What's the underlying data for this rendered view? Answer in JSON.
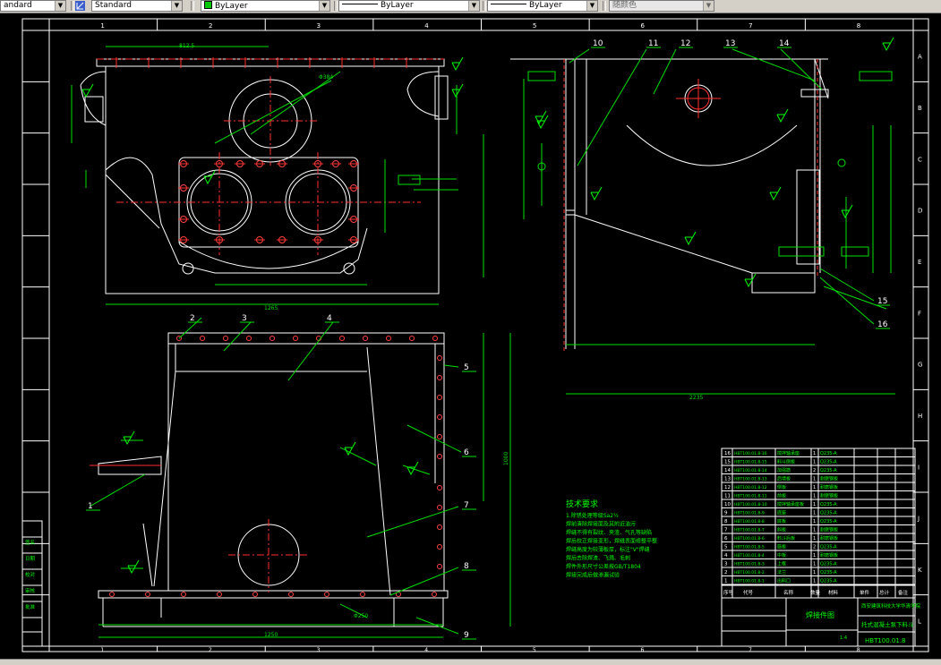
{
  "toolbar": {
    "text_style": "andard",
    "dim_style": "Standard",
    "layer": "ByLayer",
    "linetype": "ByLayer",
    "lineweight": "ByLayer",
    "plot_style": "随颜色"
  },
  "frame": {
    "col_top": [
      "1",
      "2",
      "3",
      "4",
      "5",
      "6",
      "7",
      "8"
    ],
    "col_bottom": [
      "1",
      "2",
      "3",
      "4",
      "5",
      "6",
      "7",
      "8"
    ],
    "rows": [
      "A",
      "B",
      "C",
      "D",
      "E",
      "F",
      "G",
      "H",
      "I",
      "J",
      "K",
      "L"
    ]
  },
  "balloons": [
    "1",
    "2",
    "3",
    "4",
    "5",
    "6",
    "7",
    "8",
    "9",
    "10",
    "11",
    "12",
    "13",
    "14",
    "15",
    "16"
  ],
  "tech_title": "技术要求",
  "tech_lines": [
    "1.除锈处理等级Sa2½",
    "焊前清除焊接面及其附近油污",
    "焊缝不得有裂纹、夹渣、气孔等缺陷",
    "焊后校正焊接变形，焊缝表面修整平整",
    "焊缝高度为较薄板厚，标注\"V\"焊缝",
    "焊后去除焊渣、飞溅、毛刺",
    "焊件外形尺寸公差按GB/T1804",
    "焊接完成后做渗漏试验"
  ],
  "dims": {
    "top_overall": "1265",
    "top_width": "812.5",
    "side_total": "2235",
    "front_width": "1250",
    "front_height": "1000",
    "hole_top": "Φ384",
    "bottom_hole": "Φ250",
    "front_bottom": "1250"
  },
  "title_block": {
    "school": "西安建筑科技大学华清学院",
    "title": "焊接件图",
    "part_name": "托式混凝土泵下料斗",
    "drawing_no": "HBT100.01.8",
    "scale": "1:4",
    "header": [
      "序号",
      "代号",
      "名称",
      "数量",
      "材料",
      "单件",
      "总计",
      "备注"
    ]
  },
  "parts": [
    {
      "no": "16",
      "code": "HBT100.01.8-16",
      "name": "搅拌轴承座",
      "qty": "1",
      "mat": "Q235-A"
    },
    {
      "no": "15",
      "code": "HBT100.01.8-15",
      "name": "料斗侧板",
      "qty": "1",
      "mat": "Q235-A"
    },
    {
      "no": "14",
      "code": "HBT100.01.8-14",
      "name": "加强筋",
      "qty": "2",
      "mat": "Q235-A"
    },
    {
      "no": "13",
      "code": "HBT100.01.8-13",
      "name": "后墙板",
      "qty": "1",
      "mat": "耐磨钢板"
    },
    {
      "no": "12",
      "code": "HBT100.01.8-12",
      "name": "侧板",
      "qty": "1",
      "mat": "耐磨钢板"
    },
    {
      "no": "11",
      "code": "HBT100.01.8-11",
      "name": "前板",
      "qty": "1",
      "mat": "耐磨钢板"
    },
    {
      "no": "10",
      "code": "HBT100.01.8-10",
      "name": "搅拌轴承座板",
      "qty": "1",
      "mat": "Q235-A"
    },
    {
      "no": "9",
      "code": "HBT100.01.8-9",
      "name": "底座",
      "qty": "1",
      "mat": "Q235-A"
    },
    {
      "no": "8",
      "code": "HBT100.01.8-8",
      "name": "底板",
      "qty": "1",
      "mat": "Q235-A"
    },
    {
      "no": "7",
      "code": "HBT100.01.8-7",
      "name": "斜板",
      "qty": "1",
      "mat": "耐磨钢板"
    },
    {
      "no": "6",
      "code": "HBT100.01.8-6",
      "name": "料斗后板",
      "qty": "1",
      "mat": "耐磨钢板"
    },
    {
      "no": "5",
      "code": "HBT100.01.8-5",
      "name": "筋板",
      "qty": "2",
      "mat": "Q235-A"
    },
    {
      "no": "4",
      "code": "HBT100.01.8-4",
      "name": "中板",
      "qty": "1",
      "mat": "耐磨钢板"
    },
    {
      "no": "3",
      "code": "HBT100.01.8-3",
      "name": "上框",
      "qty": "1",
      "mat": "Q235-A"
    },
    {
      "no": "2",
      "code": "HBT100.01.8-2",
      "name": "法兰",
      "qty": "1",
      "mat": "Q235-A"
    },
    {
      "no": "1",
      "code": "HBT100.01.8-1",
      "name": "出料口",
      "qty": "1",
      "mat": "Q235-A"
    }
  ],
  "sidebar_labels": [
    "签名",
    "日期",
    "校对",
    "审核",
    "批准"
  ]
}
